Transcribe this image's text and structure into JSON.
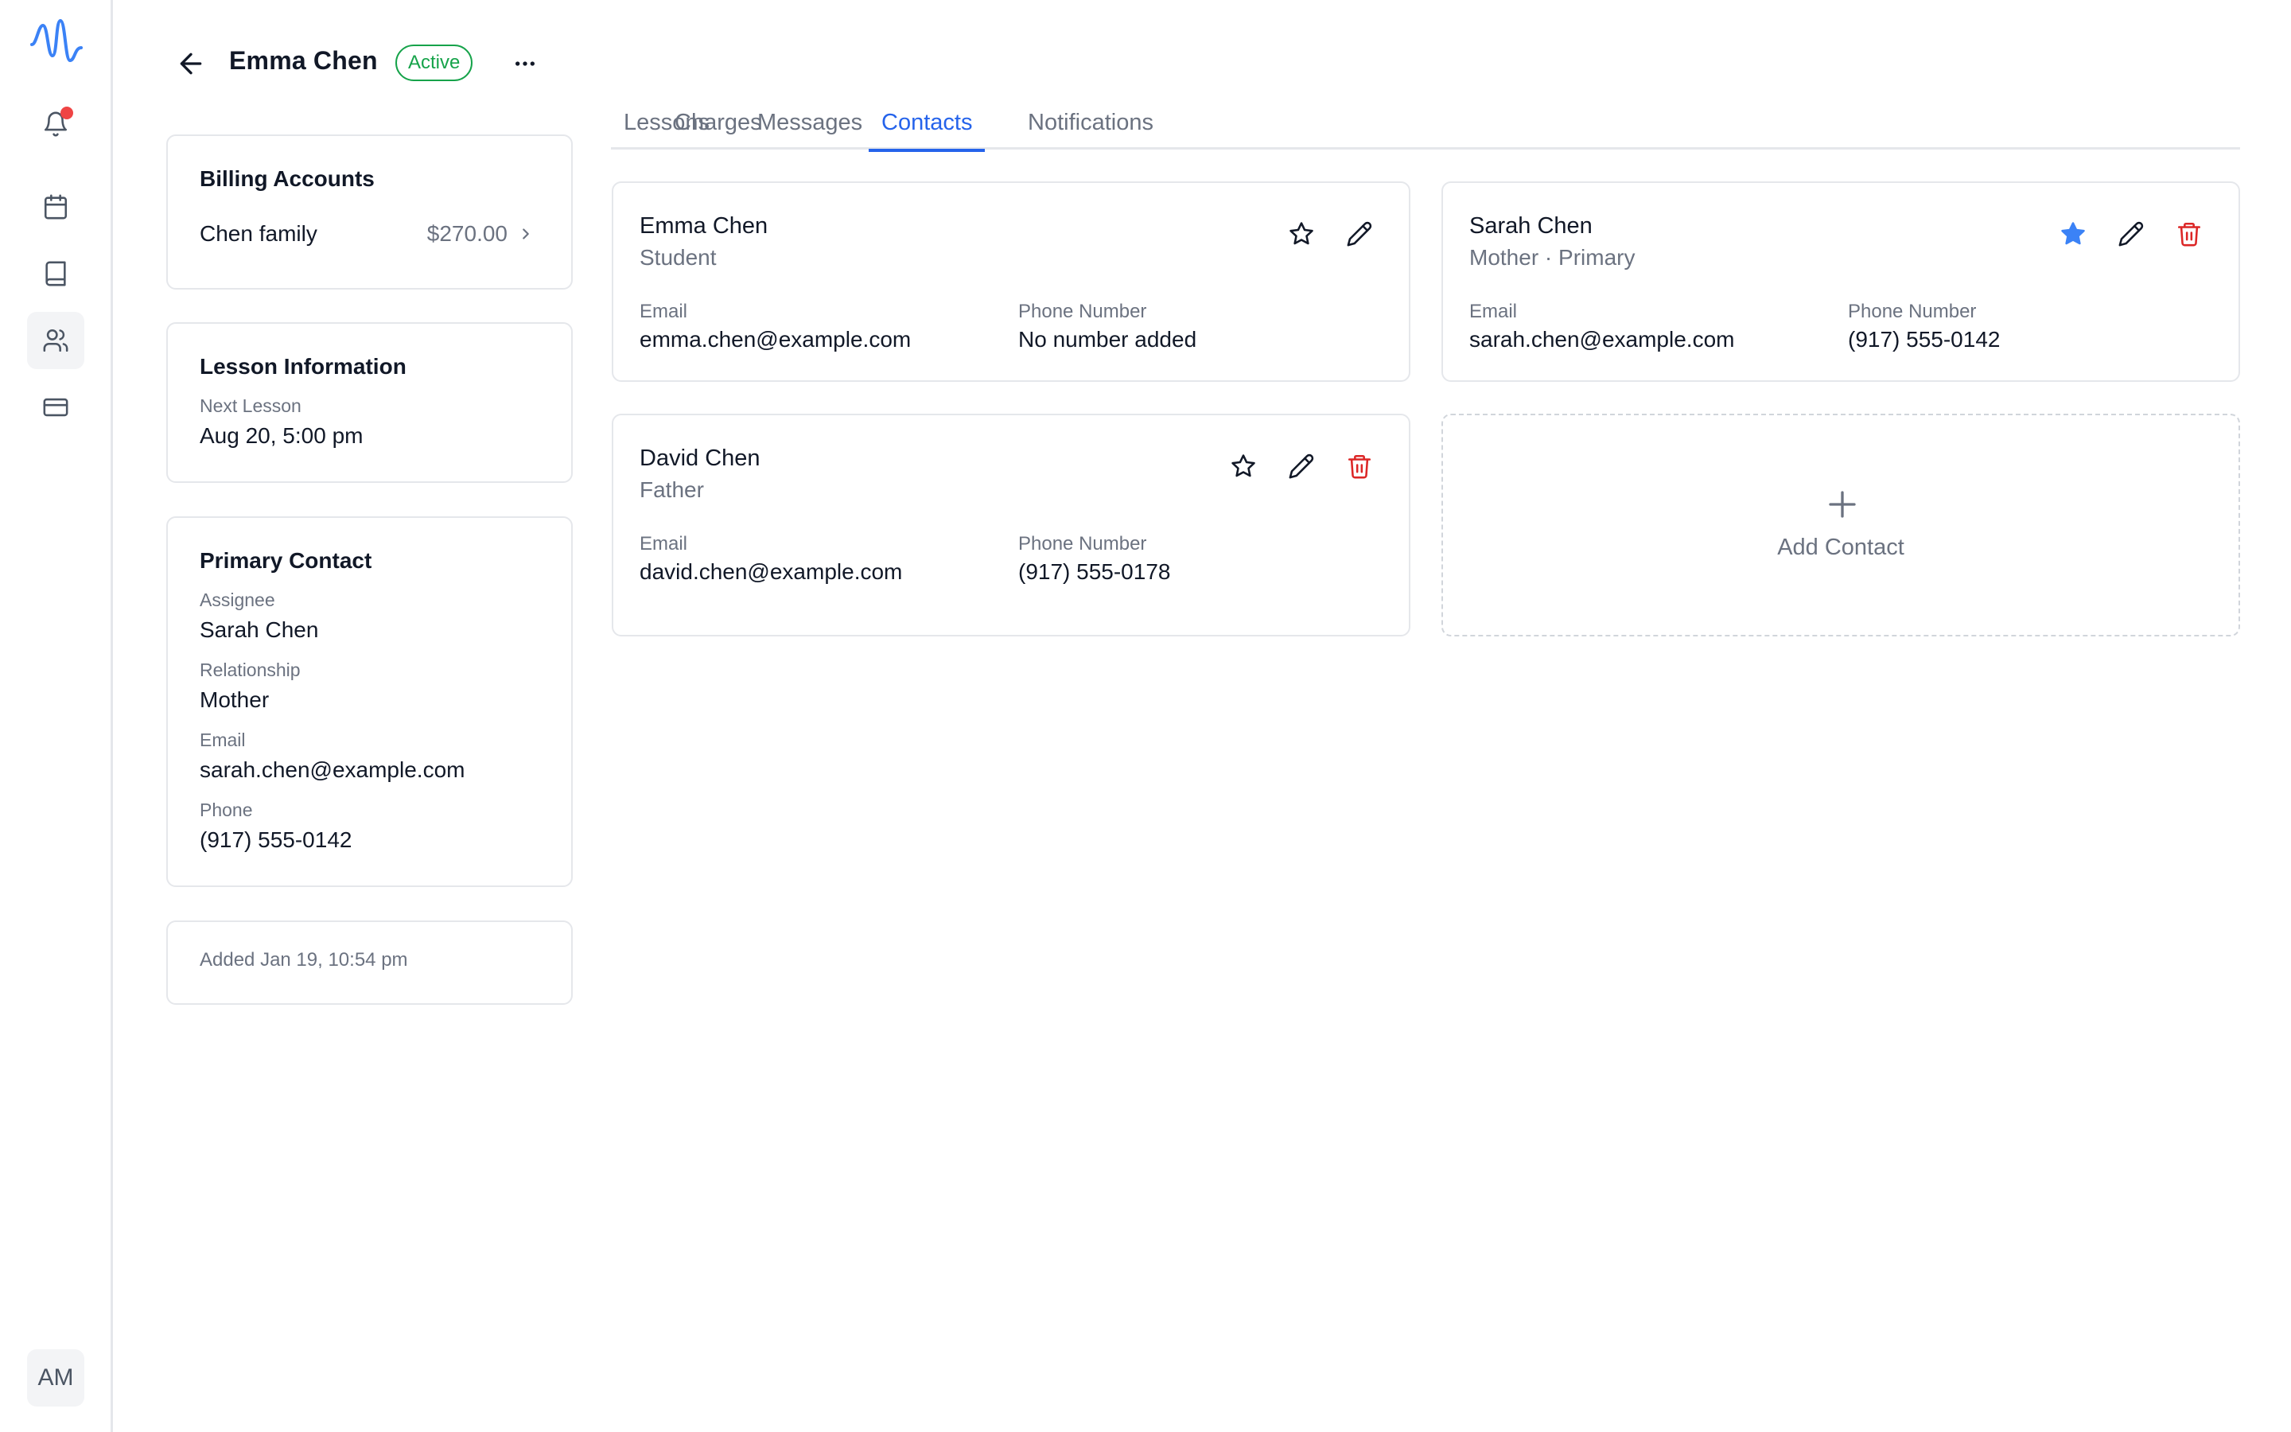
{
  "sidebar": {
    "logo": "app-logo-wave-icon",
    "items": [
      {
        "icon": "bell-icon",
        "has_notification": true
      },
      {
        "icon": "calendar-icon"
      },
      {
        "icon": "book-icon"
      },
      {
        "icon": "users-icon",
        "active": true
      },
      {
        "icon": "credit-card-icon"
      }
    ],
    "user_initials": "AM"
  },
  "header": {
    "title": "Emma Chen",
    "status": "Active"
  },
  "billing": {
    "title": "Billing Accounts",
    "account_name": "Chen family",
    "account_amount": "$270.00"
  },
  "lesson_info": {
    "title": "Lesson Information",
    "next_label": "Next Lesson",
    "next_value": "Aug 20, 5:00 pm"
  },
  "primary_contact": {
    "title": "Primary Contact",
    "assignee_label": "Assignee",
    "assignee_value": "Sarah Chen",
    "relationship_label": "Relationship",
    "relationship_value": "Mother",
    "email_label": "Email",
    "email_value": "sarah.chen@example.com",
    "phone_label": "Phone",
    "phone_value": "(917) 555-0142"
  },
  "added": {
    "text": "Added Jan 19, 10:54 pm"
  },
  "tabs": [
    {
      "label": "Lessons"
    },
    {
      "label": "Charges"
    },
    {
      "label": "Messages"
    },
    {
      "label": "Contacts",
      "active": true
    },
    {
      "label": "Notifications"
    }
  ],
  "contacts": [
    {
      "name": "Emma Chen",
      "role": "Student",
      "email_label": "Email",
      "email": "emma.chen@example.com",
      "phone_label": "Phone Number",
      "phone": "No number added",
      "starred": false,
      "deletable": false
    },
    {
      "name": "Sarah Chen",
      "role": "Mother · Primary",
      "email_label": "Email",
      "email": "sarah.chen@example.com",
      "phone_label": "Phone Number",
      "phone": "(917) 555-0142",
      "starred": true,
      "deletable": true
    },
    {
      "name": "David Chen",
      "role": "Father",
      "email_label": "Email",
      "email": "david.chen@example.com",
      "phone_label": "Phone Number",
      "phone": "(917) 555-0178",
      "starred": false,
      "deletable": true
    }
  ],
  "add_contact": {
    "label": "Add Contact"
  },
  "colors": {
    "accent": "#2563eb",
    "active_badge": "#16a34a",
    "danger": "#dc2626",
    "notification": "#ef4444",
    "star_filled": "#3b82f6"
  }
}
